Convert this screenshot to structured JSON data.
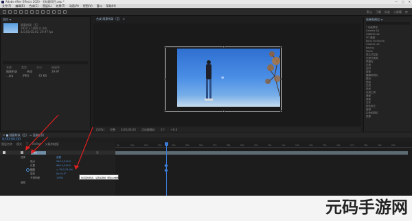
{
  "app": {
    "window_title": "Adobe After Effects 2020 - 无标题项目.aep *",
    "win_controls": [
      "—",
      "□",
      "✕"
    ],
    "menu": [
      "文件(F)",
      "编辑(E)",
      "合成(C)",
      "图层(L)",
      "效果(T)",
      "动画(A)",
      "视图(V)",
      "窗口",
      "帮助(H)"
    ],
    "toolbar_right": [
      "默认",
      "了解",
      "标准",
      "小屏幕",
      "库"
    ]
  },
  "project": {
    "tab": "项目 ≡",
    "item_name": "随意附录（互）",
    "item_info": "1920 x 1080 (1.00)",
    "item_info2": "Δ 0;00;05;00, 29.97 fps",
    "columns": [
      "名称",
      "类型",
      "大小",
      "帧速率"
    ],
    "rows": [
      {
        "name": "随意附录",
        "type": "合成",
        "size": "",
        "fps": "29.97"
      },
      {
        "name": "...jpg",
        "type": "JPEG",
        "size": "45 KB",
        "fps": ""
      }
    ]
  },
  "composition": {
    "tab": "合成 随意附录（互） ≡",
    "footer": [
      "(50%)",
      "完整",
      "0;00;00;00",
      "活动摄像机",
      "1个",
      "+0.0"
    ]
  },
  "effects_panel": {
    "tab": "效果和预设 ≡",
    "items": [
      "* 动画预设",
      "Cinema 4D",
      "CINEMA 4D",
      "3D 通道",
      "Boris FX Mocha",
      "CINEMA 4D",
      "Keying",
      "Matte",
      "表达式控制",
      "沉浸式视频",
      "风格化",
      "过渡",
      "过时",
      "抠像",
      "模糊和锐化",
      "模拟",
      "扭曲",
      "生成",
      "时间",
      "实用工具",
      "通道",
      "透视",
      "文本",
      "颜色校正",
      "音频",
      "杂色和颗粒",
      "遮罩"
    ]
  },
  "timeline": {
    "tabs": "× ■ 随意附录（互） ≡     渲染队列",
    "time": "0;00;00;00",
    "head": [
      "图层名称",
      "模式",
      "T",
      "TrkMat",
      "父级和链接"
    ],
    "layer_label": "1.jpg",
    "layer_parent": "无",
    "properties": [
      "变换",
      "锚点",
      "位置",
      "缩放",
      "旋转",
      "不透明度",
      "音频"
    ],
    "values": [
      "重置",
      "960.0,540.0",
      "960.0,540.0",
      "∞ 79.0,79.0%",
      "0x+0.0°",
      "100%"
    ],
    "ruler": [
      "0s",
      "01s",
      "02s",
      "03s",
      "04s",
      "05s",
      "06s",
      "07s",
      "08s",
      "09s",
      "10s",
      "11s",
      "12s",
      "13s",
      "14s",
      "15s",
      "16s",
      "17s",
      "18s",
      "19s",
      "20s"
    ],
    "tooltip": "时间变化秒表，设置关键帧（按住Alt单击）"
  },
  "watermark": "元码手游网"
}
